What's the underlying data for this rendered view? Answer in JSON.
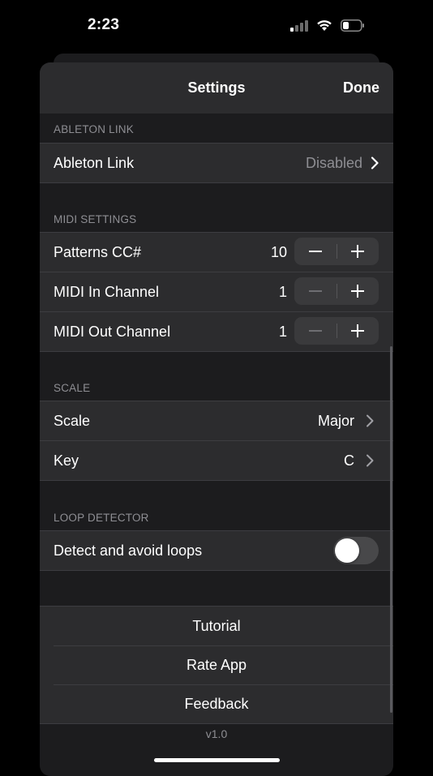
{
  "status_bar": {
    "time": "2:23"
  },
  "nav": {
    "title": "Settings",
    "done_label": "Done"
  },
  "sections": {
    "ableton": {
      "header": "ABLETON LINK",
      "row": {
        "label": "Ableton Link",
        "value": "Disabled"
      }
    },
    "midi": {
      "header": "MIDI SETTINGS",
      "rows": [
        {
          "label": "Patterns CC#",
          "value": "10"
        },
        {
          "label": "MIDI In Channel",
          "value": "1"
        },
        {
          "label": "MIDI Out Channel",
          "value": "1"
        }
      ]
    },
    "scale": {
      "header": "SCALE",
      "rows": [
        {
          "label": "Scale",
          "value": "Major"
        },
        {
          "label": "Key",
          "value": "C"
        }
      ]
    },
    "loop": {
      "header": "LOOP DETECTOR",
      "row": {
        "label": "Detect and avoid loops",
        "toggle_on": false
      }
    }
  },
  "links": [
    "Tutorial",
    "Rate App",
    "Feedback"
  ],
  "version": "v1.0",
  "colors": {
    "background": "#000000",
    "sheet": "#1c1c1e",
    "cell": "#2c2c2e",
    "secondary_text": "#8e8e93"
  },
  "icons": [
    "signal-icon",
    "wifi-icon",
    "battery-icon",
    "chevron-right-icon",
    "minus-icon",
    "plus-icon"
  ]
}
